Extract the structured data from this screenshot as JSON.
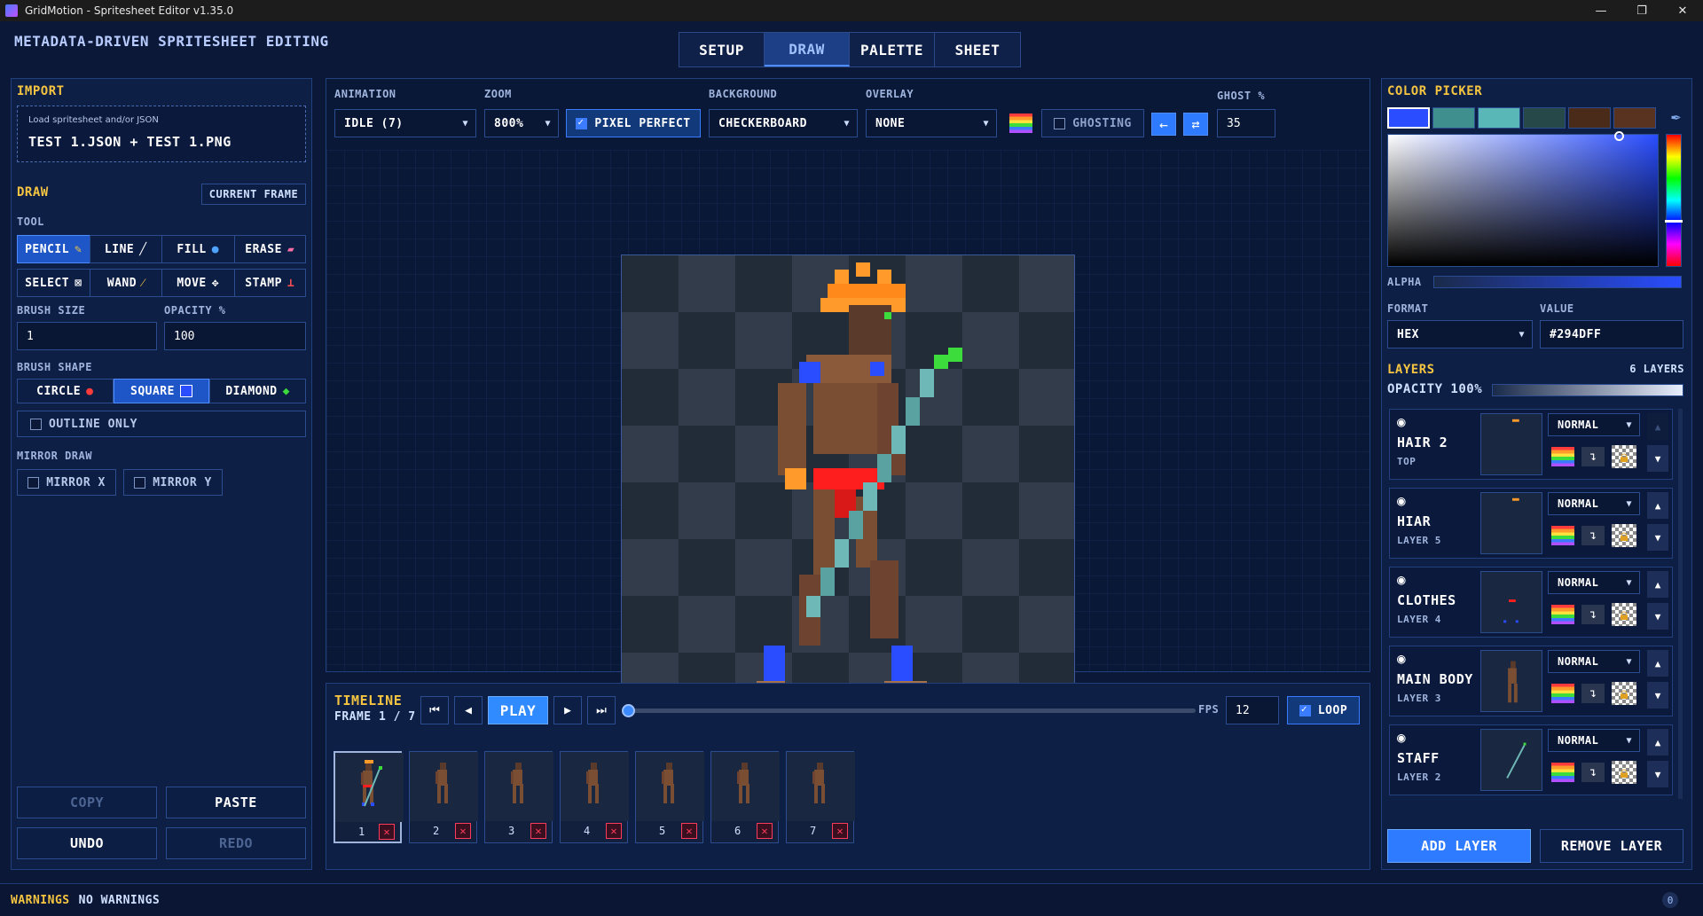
{
  "window": {
    "title": "GridMotion - Spritesheet Editor v1.35.0",
    "minimize": "—",
    "maximize": "❐",
    "close": "✕"
  },
  "header": {
    "subtitle": "METADATA-DRIVEN SPRITESHEET EDITING",
    "tabs": [
      "SETUP",
      "DRAW",
      "PALETTE",
      "SHEET"
    ],
    "active_tab": "DRAW"
  },
  "import": {
    "title": "IMPORT",
    "hint": "Load spritesheet and/or JSON",
    "files": "TEST 1.JSON + TEST 1.PNG"
  },
  "draw": {
    "title": "DRAW",
    "current_frame_button": "CURRENT FRAME",
    "tool_label": "TOOL",
    "tools": [
      "PENCIL",
      "LINE",
      "FILL",
      "ERASE",
      "SELECT",
      "WAND",
      "MOVE",
      "STAMP"
    ],
    "active_tool": "PENCIL",
    "brush_size_label": "BRUSH SIZE",
    "brush_size": "1",
    "opacity_label": "OPACITY %",
    "opacity": "100",
    "brush_shape_label": "BRUSH SHAPE",
    "shapes": [
      "CIRCLE",
      "SQUARE",
      "DIAMOND"
    ],
    "active_shape": "SQUARE",
    "outline_only": "OUTLINE ONLY",
    "mirror_label": "MIRROR DRAW",
    "mirror_x": "MIRROR X",
    "mirror_y": "MIRROR Y",
    "copy": "COPY",
    "paste": "PASTE",
    "undo": "UNDO",
    "redo": "REDO"
  },
  "toolbar": {
    "animation_label": "ANIMATION",
    "animation": "IDLE (7)",
    "zoom_label": "ZOOM",
    "zoom": "800%",
    "pixel_perfect": "PIXEL PERFECT",
    "background_label": "BACKGROUND",
    "background": "CHECKERBOARD",
    "overlay_label": "OVERLAY",
    "overlay": "NONE",
    "ghosting": "GHOSTING",
    "ghost_label": "GHOST %",
    "ghost": "35"
  },
  "timeline": {
    "title": "TIMELINE",
    "frame_info": "FRAME 1 / 7",
    "play": "PLAY",
    "fps_label": "FPS",
    "fps": "12",
    "loop": "LOOP",
    "progress": 0,
    "frames": [
      "1",
      "2",
      "3",
      "4",
      "5",
      "6",
      "7"
    ]
  },
  "color_picker": {
    "title": "COLOR PICKER",
    "swatches": [
      "#294DFF",
      "#3f8f8f",
      "#5ab7b7",
      "#274848",
      "#4a2a18",
      "#5a3320"
    ],
    "alpha_label": "ALPHA",
    "format_label": "FORMAT",
    "format": "HEX",
    "value_label": "VALUE",
    "value": "#294DFF"
  },
  "layers": {
    "title": "LAYERS",
    "count": "6 LAYERS",
    "opacity": "OPACITY 100%",
    "items": [
      {
        "name": "HAIR 2",
        "sub": "TOP",
        "blend": "NORMAL"
      },
      {
        "name": "HIAR",
        "sub": "LAYER 5",
        "blend": "NORMAL"
      },
      {
        "name": "CLOTHES",
        "sub": "LAYER 4",
        "blend": "NORMAL"
      },
      {
        "name": "MAIN BODY",
        "sub": "LAYER 3",
        "blend": "NORMAL"
      },
      {
        "name": "STAFF",
        "sub": "LAYER 2",
        "blend": "NORMAL"
      }
    ],
    "add": "ADD LAYER",
    "remove": "REMOVE LAYER"
  },
  "status": {
    "warnings_label": "WARNINGS",
    "warnings": "NO WARNINGS"
  }
}
